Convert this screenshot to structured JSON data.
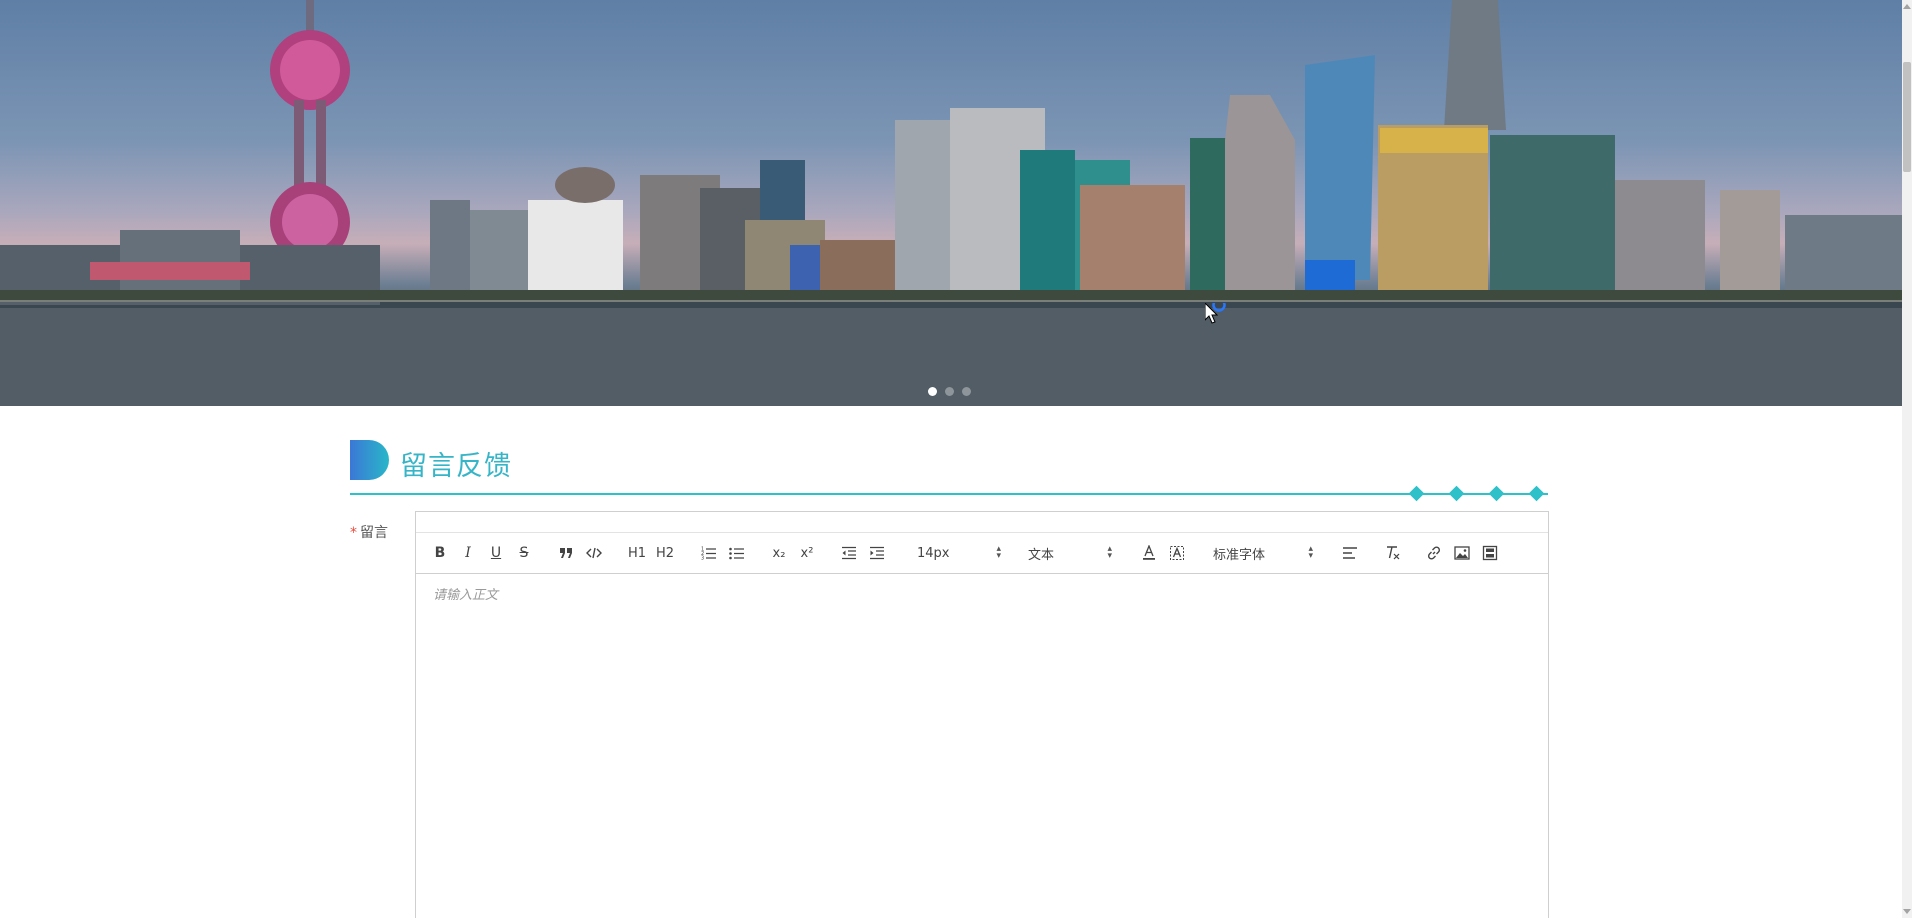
{
  "banner": {
    "carousel_dots": 3,
    "active_dot": 0
  },
  "section": {
    "title": "留言反馈"
  },
  "form": {
    "message_label": "留言",
    "required_mark": "*",
    "editor": {
      "placeholder": "请输入正文",
      "toolbar": {
        "bold": "B",
        "italic": "I",
        "underline": "U",
        "strike": "S",
        "h1": "H1",
        "h2": "H2",
        "subscript": "x₂",
        "superscript": "x²",
        "font_size": "14px",
        "block_format": "文本",
        "font_family": "标准字体"
      }
    }
  },
  "colors": {
    "accent": "#2fc1c9",
    "title": "#37b5c8",
    "logo_gradient_start": "#3b78d6",
    "logo_gradient_end": "#28b7c8"
  }
}
